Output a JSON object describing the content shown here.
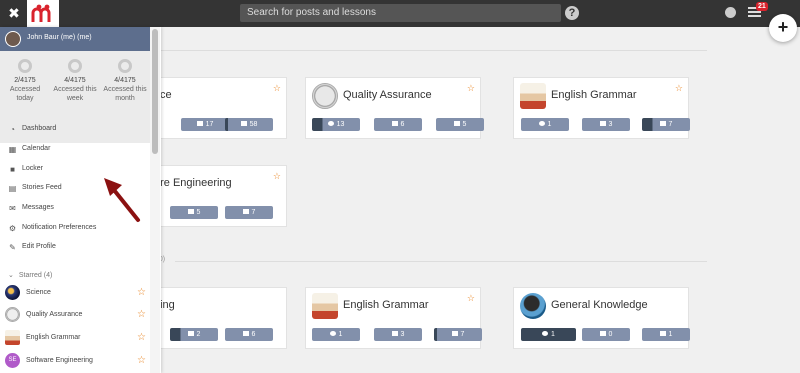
{
  "topbar": {
    "close_glyph": "✖",
    "search_placeholder": "Search for posts and lessons",
    "help_glyph": "?",
    "notification_count": "21",
    "add_glyph": "+",
    "brand_color": "#d9232d"
  },
  "sidebar": {
    "user_name": "John Baur (me) (me)",
    "stats": [
      {
        "count": "2/4175",
        "label": "Accessed today"
      },
      {
        "count": "4/4175",
        "label": "Accessed this week"
      },
      {
        "count": "4/4175",
        "label": "Accessed this month"
      }
    ],
    "menu": [
      {
        "icon": "dashboard-icon",
        "label": "Dashboard"
      },
      {
        "icon": "calendar-icon",
        "label": "Calendar"
      },
      {
        "icon": "folder-icon",
        "label": "Locker"
      },
      {
        "icon": "stories-feed-icon",
        "label": "Stories Feed"
      },
      {
        "icon": "envelope-icon",
        "label": "Messages"
      },
      {
        "icon": "cogs-icon",
        "label": "Notification Preferences"
      },
      {
        "icon": "wrench-icon",
        "label": "Edit Profile"
      }
    ],
    "starred_header": "Starred (4)",
    "starred": [
      {
        "label": "Science",
        "initials": ""
      },
      {
        "label": "Quality Assurance",
        "initials": ""
      },
      {
        "label": "English Grammar",
        "initials": ""
      },
      {
        "label": "Software Engineering",
        "initials": "SE"
      }
    ]
  },
  "main": {
    "section2_suffix": "10)",
    "cards": [
      {
        "title": "ce",
        "chips": [
          "",
          "17",
          "58"
        ]
      },
      {
        "title": "Quality Assurance",
        "chips": [
          "13",
          "6",
          "5"
        ]
      },
      {
        "title": "English Grammar",
        "chips": [
          "1",
          "3",
          "7"
        ]
      },
      {
        "title": "are Engineering",
        "chips": [
          "",
          "5",
          "7"
        ]
      },
      {
        "title": "ning",
        "chips": [
          "",
          "2",
          "6"
        ]
      },
      {
        "title": "English Grammar",
        "chips": [
          "1",
          "3",
          "7"
        ]
      },
      {
        "title": "General Knowledge",
        "chips": [
          "1",
          "0",
          "1"
        ]
      }
    ]
  }
}
